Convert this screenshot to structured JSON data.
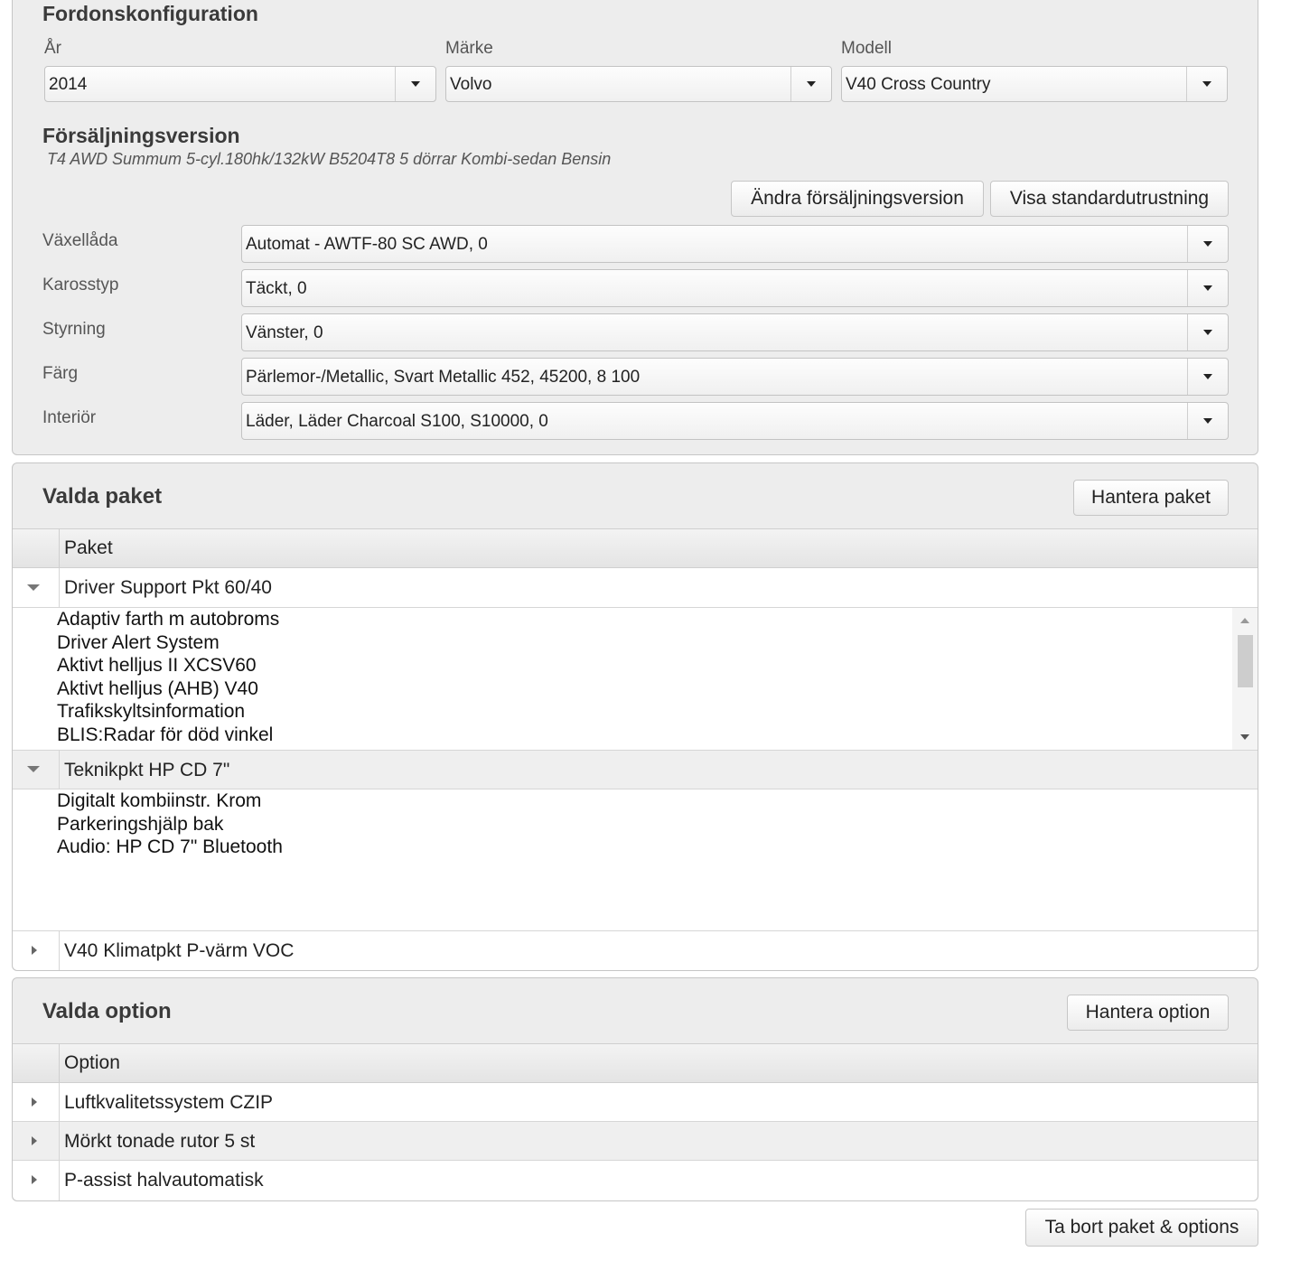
{
  "vehicle_config": {
    "title": "Fordonskonfiguration",
    "year": {
      "label": "År",
      "value": "2014"
    },
    "make": {
      "label": "Märke",
      "value": "Volvo"
    },
    "model": {
      "label": "Modell",
      "value": "V40 Cross Country"
    },
    "sales_version": {
      "title": "Försäljningsversion",
      "value": "T4 AWD Summum 5-cyl.180hk/132kW B5204T8 5 dörrar Kombi-sedan Bensin"
    },
    "buttons": {
      "change_version": "Ändra försäljningsversion",
      "show_standard": "Visa standardutrustning"
    },
    "fields": [
      {
        "label": "Växellåda",
        "value": "Automat - AWTF-80 SC AWD, 0"
      },
      {
        "label": "Karosstyp",
        "value": "Täckt, 0"
      },
      {
        "label": "Styrning",
        "value": "Vänster, 0"
      },
      {
        "label": "Färg",
        "value": "Pärlemor-/Metallic, Svart Metallic 452, 45200, 8 100"
      },
      {
        "label": "Interiör",
        "value": "Läder, Läder Charcoal S100, S10000, 0"
      }
    ]
  },
  "packages": {
    "title": "Valda paket",
    "manage_button": "Hantera paket",
    "column_header": "Paket",
    "rows": [
      {
        "name": "Driver Support Pkt 60/40",
        "expanded": true,
        "items": [
          "Adaptiv farth m autobroms",
          "Driver Alert System",
          "Aktivt helljus II XCSV60",
          "Aktivt helljus (AHB) V40",
          "Trafikskyltsinformation",
          "BLIS:Radar för död vinkel"
        ]
      },
      {
        "name": "Teknikpkt HP CD 7\"",
        "expanded": true,
        "items": [
          "Digitalt kombiinstr. Krom",
          "Parkeringshjälp bak",
          "Audio: HP CD 7\" Bluetooth"
        ]
      },
      {
        "name": "V40 Klimatpkt P-värm VOC",
        "expanded": false,
        "items": []
      }
    ]
  },
  "options": {
    "title": "Valda option",
    "manage_button": "Hantera option",
    "column_header": "Option",
    "rows": [
      {
        "name": "Luftkvalitetssystem CZIP"
      },
      {
        "name": "Mörkt tonade rutor 5 st"
      },
      {
        "name": "P-assist halvautomatisk"
      }
    ]
  },
  "footer": {
    "remove_button": "Ta bort paket & options"
  }
}
